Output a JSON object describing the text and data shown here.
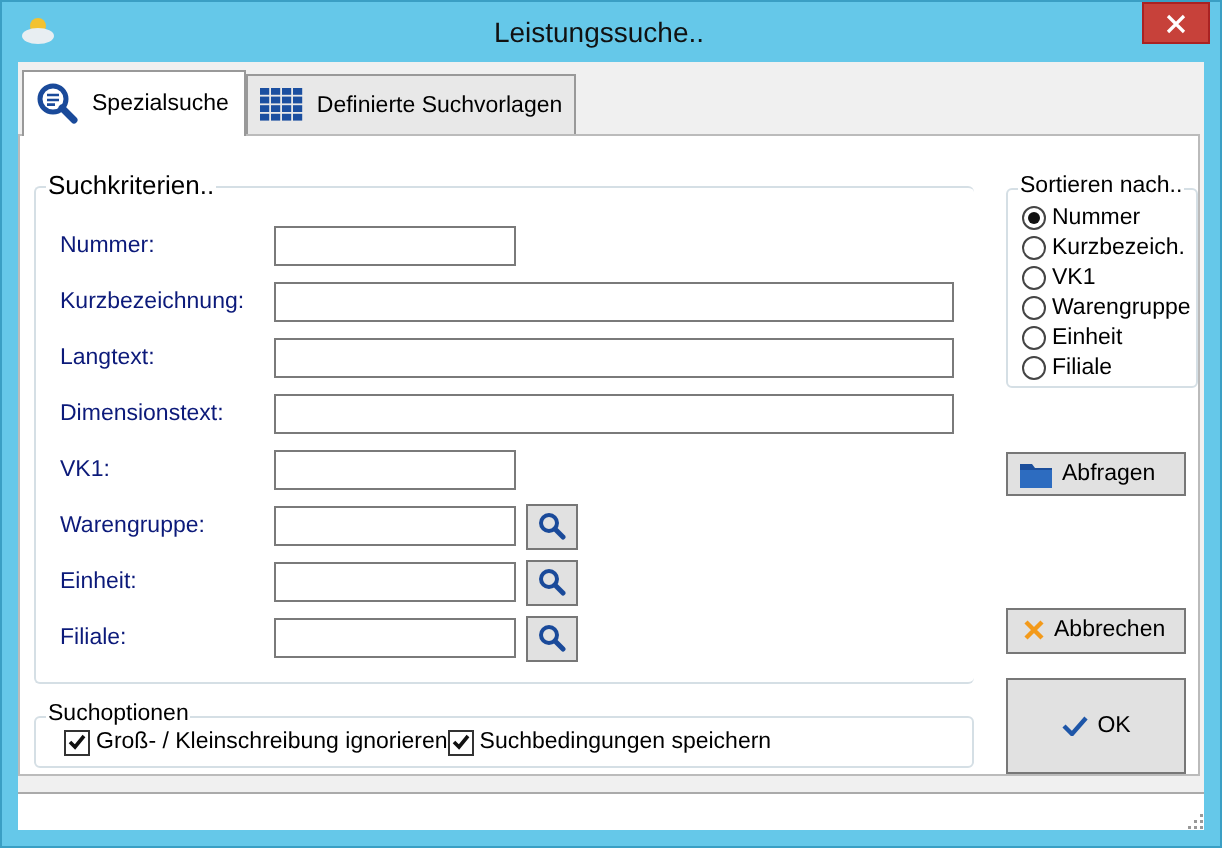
{
  "window": {
    "title": "Leistungssuche.."
  },
  "tabs": [
    {
      "label": "Spezialsuche",
      "selected": true,
      "kind": "search"
    },
    {
      "label": "Definierte Suchvorlagen",
      "selected": false,
      "kind": "grid"
    }
  ],
  "criteria": {
    "title": "Suchkriterien..",
    "fields": [
      {
        "label": "Nummer:",
        "kind": "short"
      },
      {
        "label": "Kurzbezeichnung:",
        "kind": "long"
      },
      {
        "label": "Langtext:",
        "kind": "long"
      },
      {
        "label": "Dimensionstext:",
        "kind": "long"
      },
      {
        "label": "VK1:",
        "kind": "short"
      },
      {
        "label": "Warengruppe:",
        "kind": "lookup"
      },
      {
        "label": "Einheit:",
        "kind": "lookup"
      },
      {
        "label": "Filiale:",
        "kind": "lookup"
      }
    ]
  },
  "options": {
    "title": "Suchoptionen",
    "items": [
      {
        "label": "Groß- / Kleinschreibung ignorieren",
        "checked": true
      },
      {
        "label": "Suchbedingungen speichern",
        "checked": true
      }
    ]
  },
  "sort": {
    "title": "Sortieren nach..",
    "options": [
      {
        "label": "Nummer",
        "selected": true
      },
      {
        "label": "Kurzbezeich.",
        "selected": false
      },
      {
        "label": "VK1",
        "selected": false
      },
      {
        "label": "Warengruppe",
        "selected": false
      },
      {
        "label": "Einheit",
        "selected": false
      },
      {
        "label": "Filiale",
        "selected": false
      }
    ]
  },
  "buttons": [
    {
      "label": "Abfragen",
      "kind": "query"
    },
    {
      "label": "Abbrechen",
      "kind": "cancel"
    },
    {
      "label": "OK",
      "kind": "ok"
    }
  ]
}
